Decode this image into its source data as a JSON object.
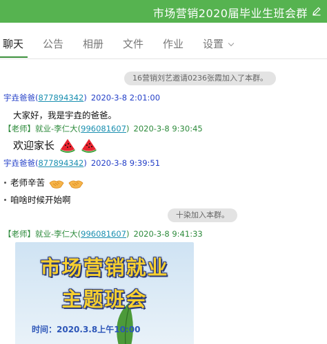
{
  "window": {
    "title": "市场营销2020届毕业生班会群",
    "edit_icon": "edit-pencil-icon",
    "accent_color": "#56b350"
  },
  "tabs": [
    {
      "label": "聊天",
      "active": true
    },
    {
      "label": "公告"
    },
    {
      "label": "相册"
    },
    {
      "label": "文件"
    },
    {
      "label": "作业"
    },
    {
      "label": "设置",
      "icon": "chevron-down-icon"
    }
  ],
  "chat": {
    "system_messages": [
      "16营销刘艺邀请0236张霞加入了本群。",
      "十染加入本群。"
    ],
    "messages": [
      {
        "sender": "宇垚爸爸",
        "qq": "877894342",
        "time": "2020-3-8 2:01:00",
        "text": "大家好，我是宇垚的爸爸。"
      },
      {
        "sender": "【老师】就业-李仁大",
        "qq": "996081607",
        "time": "2020-3-8 9:30:45",
        "text": "欢迎家长",
        "emojis": [
          "watermelon-icon",
          "watermelon-icon"
        ]
      },
      {
        "sender": "宇垚爸爸",
        "qq": "877894342",
        "time": "2020-3-8 9:39:51",
        "lines": [
          "老师辛苦",
          "咱啥时候开始啊"
        ],
        "emojis": [
          "handshake-icon",
          "handshake-icon"
        ]
      },
      {
        "sender": "【老师】就业-李仁大",
        "qq": "996081607",
        "time": "2020-3-8 9:41:33"
      }
    ],
    "poster": {
      "title_line1": "市场营销就业",
      "title_line2": "主题班会",
      "time_text": "时间：2020.3.8上午10:00"
    }
  }
}
